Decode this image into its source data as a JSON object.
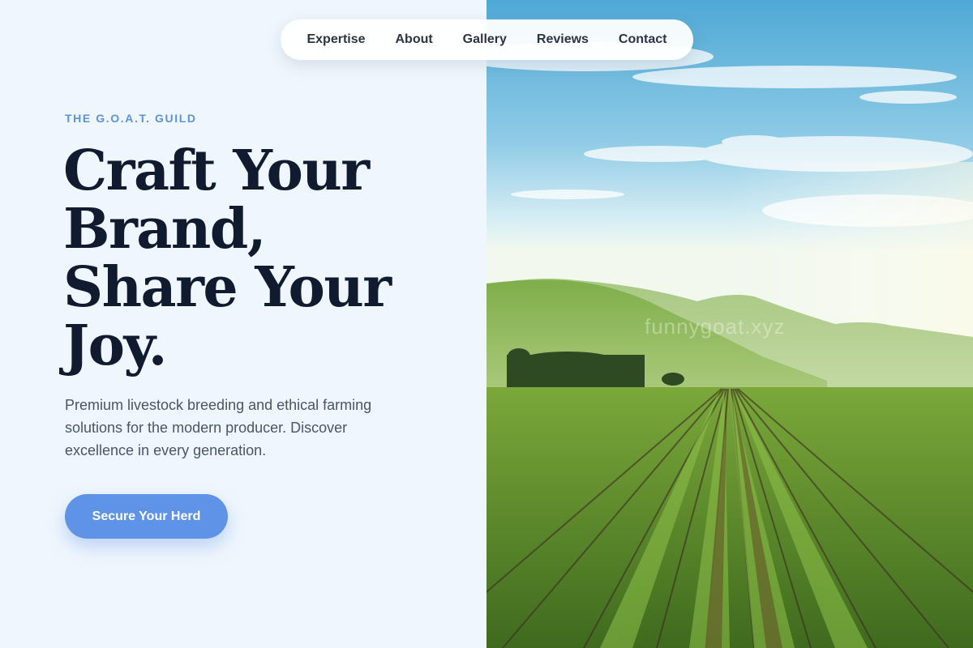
{
  "nav": {
    "items": [
      {
        "label": "Expertise"
      },
      {
        "label": "About"
      },
      {
        "label": "Gallery"
      },
      {
        "label": "Reviews"
      },
      {
        "label": "Contact"
      }
    ]
  },
  "hero": {
    "eyebrow": "THE G.O.A.T. GUILD",
    "headline": [
      "Craft Your",
      "Brand,",
      "Share Your",
      "Joy."
    ],
    "description": "Premium livestock breeding and ethical farming solutions for the modern producer. Discover excellence in every generation.",
    "cta_label": "Secure Your Herd"
  },
  "image": {
    "watermark": "funnygoat.xyz",
    "subject": "vineyard-landscape"
  },
  "colors": {
    "accent": "#5f93e8",
    "eyebrow": "#5b93dc",
    "headline": "#101b30",
    "background": "#eff6fd"
  }
}
